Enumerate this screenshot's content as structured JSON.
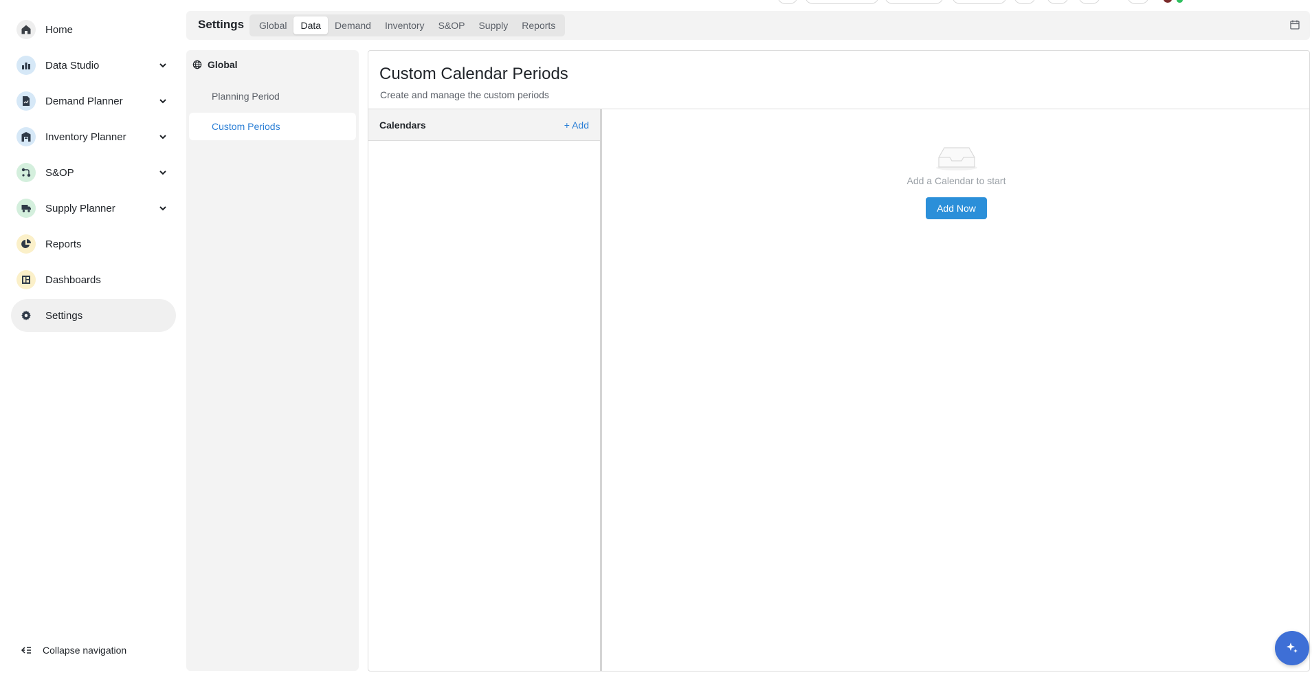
{
  "sidebar": {
    "items": [
      {
        "label": "Home",
        "icon": "home-icon",
        "icon_bg": "#eeeeee",
        "expandable": false
      },
      {
        "label": "Data Studio",
        "icon": "bar-chart-icon",
        "icon_bg": "#d6e8f7",
        "expandable": true
      },
      {
        "label": "Demand Planner",
        "icon": "document-chart-icon",
        "icon_bg": "#d6e8f7",
        "expandable": true
      },
      {
        "label": "Inventory Planner",
        "icon": "warehouse-icon",
        "icon_bg": "#d6e8f7",
        "expandable": true
      },
      {
        "label": "S&OP",
        "icon": "flow-icon",
        "icon_bg": "#d4efdd",
        "expandable": true
      },
      {
        "label": "Supply Planner",
        "icon": "truck-icon",
        "icon_bg": "#d4efdd",
        "expandable": true
      },
      {
        "label": "Reports",
        "icon": "pie-chart-icon",
        "icon_bg": "#fbf0c9",
        "expandable": false
      },
      {
        "label": "Dashboards",
        "icon": "dashboard-icon",
        "icon_bg": "#fbf0c9",
        "expandable": false
      },
      {
        "label": "Settings",
        "icon": "gear-icon",
        "icon_bg": "#f0f0f0",
        "expandable": false,
        "active": true
      }
    ],
    "collapse_label": "Collapse navigation"
  },
  "header": {
    "title": "Settings",
    "tabs": [
      "Global",
      "Data",
      "Demand",
      "Inventory",
      "S&OP",
      "Supply",
      "Reports"
    ],
    "active_tab": "Data"
  },
  "subnav": {
    "heading": "Global",
    "items": [
      "Planning Period",
      "Custom Periods"
    ],
    "active_item": "Custom Periods"
  },
  "main": {
    "title": "Custom Calendar Periods",
    "subtitle": "Create and manage the custom periods",
    "calendars": {
      "heading": "Calendars",
      "add_label": "+ Add"
    },
    "empty_state": {
      "text": "Add a Calendar to start",
      "button_label": "Add Now"
    }
  },
  "colors": {
    "accent": "#2b7fd6",
    "button": "#2b8fd9",
    "fab": "#3e6fd6"
  }
}
